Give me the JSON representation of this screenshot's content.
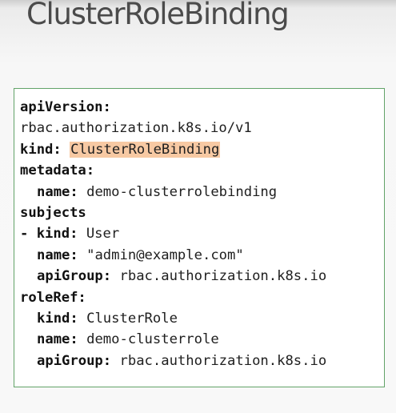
{
  "slide": {
    "title": "ClusterRoleBinding"
  },
  "yaml": {
    "api_version_key": "apiVersion:",
    "api_version_value": "rbac.authorization.k8s.io/v1",
    "kind_key": "kind:",
    "kind_value": "ClusterRoleBinding",
    "metadata_key": "metadata:",
    "metadata_name_key": "name:",
    "metadata_name_value": "demo-clusterrolebinding",
    "subjects_key": "subjects",
    "subject_dash": "- ",
    "subject_kind_key": "kind:",
    "subject_kind_value": "User",
    "subject_name_key": "name:",
    "subject_name_value": "\"admin@example.com\"",
    "subject_apigroup_key": "apiGroup:",
    "subject_apigroup_value": "rbac.authorization.k8s.io",
    "roleref_key": "roleRef:",
    "roleref_kind_key": "kind:",
    "roleref_kind_value": "ClusterRole",
    "roleref_name_key": "name:",
    "roleref_name_value": "demo-clusterrole",
    "roleref_apigroup_key": "apiGroup:",
    "roleref_apigroup_value": "rbac.authorization.k8s.io"
  },
  "colors": {
    "highlight": "#f7c9a3",
    "box_border": "#62a368",
    "title_text": "#4b4b4b"
  }
}
